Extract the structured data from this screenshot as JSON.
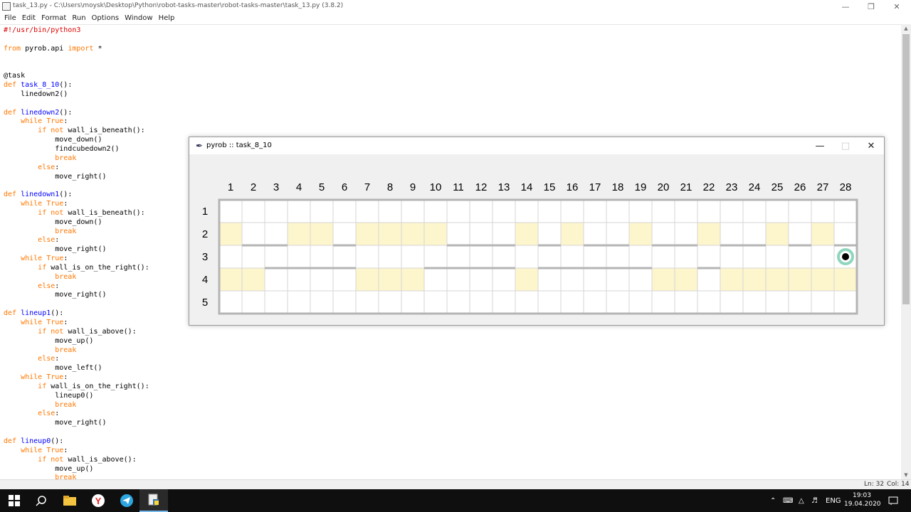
{
  "idle": {
    "title": "task_13.py - C:\\Users\\moysk\\Desktop\\Python\\robot-tasks-master\\robot-tasks-master\\task_13.py (3.8.2)",
    "menu": [
      "File",
      "Edit",
      "Format",
      "Run",
      "Options",
      "Window",
      "Help"
    ],
    "status": {
      "ln": "Ln: 32",
      "col": "Col: 14"
    }
  },
  "code_lines": [
    "#!/usr/bin/python3",
    "",
    "from pyrob.api import *",
    "",
    "",
    "@task",
    "def task_8_10():",
    "    linedown2()",
    "",
    "def linedown2():",
    "    while True:",
    "        if not wall_is_beneath():",
    "            move_down()",
    "            findcubedown2()",
    "            break",
    "        else:",
    "            move_right()",
    "",
    "def linedown1():",
    "    while True:",
    "        if not wall_is_beneath():",
    "            move_down()",
    "            break",
    "        else:",
    "            move_right()",
    "    while True:",
    "        if wall_is_on_the_right():",
    "            break",
    "        else:",
    "            move_right()",
    "",
    "def lineup1():",
    "    while True:",
    "        if not wall_is_above():",
    "            move_up()",
    "            break",
    "        else:",
    "            move_left()",
    "    while True:",
    "        if wall_is_on_the_right():",
    "            lineup0()",
    "            break",
    "        else:",
    "            move_right()",
    "",
    "def lineup0():",
    "    while True:",
    "        if not wall_is_above():",
    "            move_up()",
    "            break"
  ],
  "pyrob": {
    "title": "pyrob :: task_8_10",
    "columns": [
      "1",
      "2",
      "3",
      "4",
      "5",
      "6",
      "7",
      "8",
      "9",
      "10",
      "11",
      "12",
      "13",
      "14",
      "15",
      "16",
      "17",
      "18",
      "19",
      "20",
      "21",
      "22",
      "23",
      "24",
      "25",
      "26",
      "27",
      "28"
    ],
    "rows": [
      "1",
      "2",
      "3",
      "4",
      "5"
    ],
    "grid": {
      "filled_cells": [
        [
          2,
          1
        ],
        [
          2,
          4
        ],
        [
          2,
          5
        ],
        [
          2,
          7
        ],
        [
          2,
          8
        ],
        [
          2,
          9
        ],
        [
          2,
          10
        ],
        [
          2,
          14
        ],
        [
          2,
          16
        ],
        [
          2,
          19
        ],
        [
          2,
          22
        ],
        [
          2,
          25
        ],
        [
          2,
          27
        ],
        [
          4,
          1
        ],
        [
          4,
          2
        ],
        [
          4,
          7
        ],
        [
          4,
          8
        ],
        [
          4,
          9
        ],
        [
          4,
          14
        ],
        [
          4,
          20
        ],
        [
          4,
          21
        ],
        [
          4,
          23
        ],
        [
          4,
          24
        ],
        [
          4,
          25
        ],
        [
          4,
          26
        ],
        [
          4,
          27
        ],
        [
          4,
          28
        ]
      ],
      "walls_below_row2": [
        2,
        3,
        6,
        11,
        12,
        13,
        15,
        17,
        18,
        20,
        21,
        23,
        24,
        26,
        28
      ],
      "walls_below_row3": [
        3,
        4,
        5,
        6,
        10,
        11,
        12,
        13,
        15,
        16,
        17,
        18,
        19,
        22
      ],
      "robot": {
        "row": 3,
        "col": 28
      },
      "colors": {
        "filled": "#fdf5cc",
        "wall": "#b4b4b4",
        "grid": "#d6d6d6",
        "robot_ring": "#8fd6bf",
        "robot": "#000000"
      }
    }
  },
  "taskbar": {
    "lang": "ENG",
    "time": "19:03",
    "date": "19.04.2020",
    "icons": [
      "windows-start-icon",
      "search-icon",
      "file-explorer-icon",
      "yandex-browser-icon",
      "telegram-icon",
      "python-idle-icon"
    ]
  }
}
